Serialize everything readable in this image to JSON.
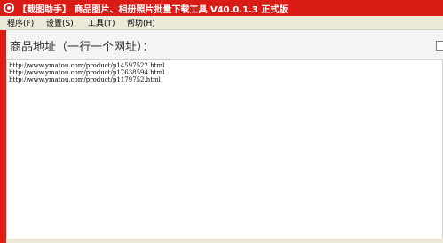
{
  "window": {
    "title": "【截图助手】 商品图片、相册照片批量下载工具 V40.0.1.3 正式版"
  },
  "menu": {
    "items": [
      "程序(F)",
      "设置(S)",
      "工具(T)",
      "帮助(H)"
    ]
  },
  "main": {
    "url_label": "商品地址（一行一个网址）：",
    "lines": [
      "http://www.ymatou.com/product/p14597522.html",
      "http://www.ymatou.com/product/p17638594.html",
      "http://www.ymatou.com/product/p1179752.html"
    ]
  },
  "colors": {
    "titlebar": "#d91c15",
    "accent_bar": "#e01b12",
    "panel_bg": "#ece9d8"
  },
  "icons": {
    "app": "app-logo-icon"
  }
}
